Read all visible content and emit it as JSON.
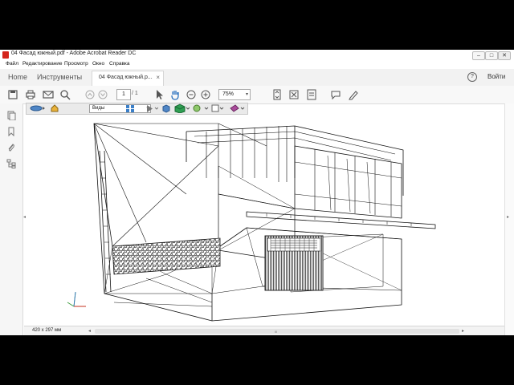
{
  "window": {
    "title": "04 Фасад южный.pdf - Adobe Acrobat Reader DC",
    "minimize": "–",
    "maximize": "□",
    "close": "✕"
  },
  "menu": [
    "Файл",
    "Редактирование",
    "Просмотр",
    "Окно",
    "Справка"
  ],
  "tabs": {
    "home": "Home",
    "tools": "Инструменты",
    "document": "04 Фасад южный.p...",
    "close": "×"
  },
  "header": {
    "help": "?",
    "signin": "Войти"
  },
  "toolbar": {
    "page_current": "1",
    "page_total": "/ 1",
    "zoom": "75%",
    "zoom_arrow": "▾"
  },
  "toolbar3d": {
    "views_label": "Виды",
    "views_arrow": "▾"
  },
  "status": {
    "page_size": "420 x 297 мм",
    "scroll_left": "◂",
    "scroll_right": "▸",
    "scroll_grip": "III"
  },
  "side_collapse": {
    "left": "◂",
    "right": "▸"
  },
  "colors": {
    "accent_red": "#d4251c",
    "accent_blue": "#2f75c0"
  }
}
